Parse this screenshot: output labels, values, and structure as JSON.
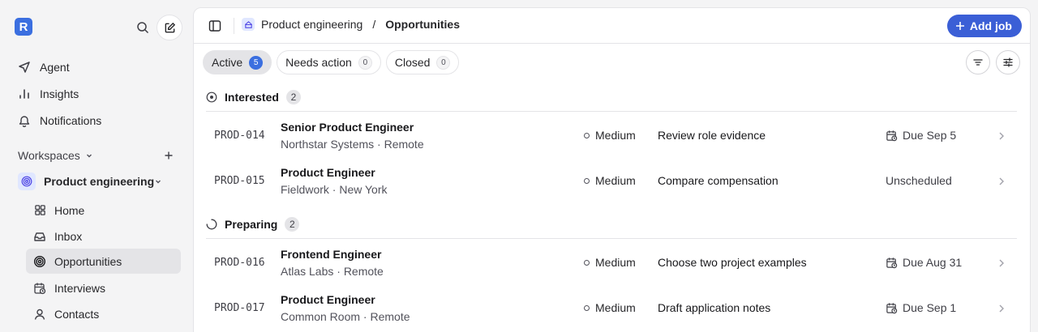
{
  "brand": {
    "letter": "R"
  },
  "sidebar": {
    "nav": [
      {
        "label": "Agent",
        "icon": "send-icon"
      },
      {
        "label": "Insights",
        "icon": "bar-chart-icon"
      },
      {
        "label": "Notifications",
        "icon": "bell-icon"
      }
    ],
    "workspaces_label": "Workspaces",
    "workspace": {
      "name": "Product engineering"
    },
    "sub_items": [
      {
        "label": "Home",
        "icon": "grid-icon"
      },
      {
        "label": "Inbox",
        "icon": "inbox-icon"
      },
      {
        "label": "Opportunities",
        "icon": "target-icon",
        "active": true
      },
      {
        "label": "Interviews",
        "icon": "calendar-clock-icon"
      },
      {
        "label": "Contacts",
        "icon": "person-icon"
      }
    ]
  },
  "header": {
    "breadcrumb_workspace": "Product engineering",
    "breadcrumb_separator": "/",
    "breadcrumb_current": "Opportunities",
    "add_job_label": "Add job"
  },
  "tabs": [
    {
      "label": "Active",
      "count": "5",
      "active": true
    },
    {
      "label": "Needs action",
      "count": "0"
    },
    {
      "label": "Closed",
      "count": "0"
    }
  ],
  "groups": [
    {
      "label": "Interested",
      "count": "2",
      "icon": "circle-dot-icon",
      "rows": [
        {
          "code": "PROD-014",
          "title": "Senior Product Engineer",
          "sub": "Northstar Systems · Remote",
          "priority": "Medium",
          "task": "Review role evidence",
          "due": "Due Sep 5",
          "has_due_icon": true
        },
        {
          "code": "PROD-015",
          "title": "Product Engineer",
          "sub": "Fieldwork · New York",
          "priority": "Medium",
          "task": "Compare compensation",
          "due": "Unscheduled",
          "has_due_icon": false
        }
      ]
    },
    {
      "label": "Preparing",
      "count": "2",
      "icon": "progress-spinner-icon",
      "rows": [
        {
          "code": "PROD-016",
          "title": "Frontend Engineer",
          "sub": "Atlas Labs · Remote",
          "priority": "Medium",
          "task": "Choose two project examples",
          "due": "Due Aug 31",
          "has_due_icon": true
        },
        {
          "code": "PROD-017",
          "title": "Product Engineer",
          "sub": "Common Room · Remote",
          "priority": "Medium",
          "task": "Draft application notes",
          "due": "Due Sep 1",
          "has_due_icon": true
        }
      ]
    }
  ],
  "colors": {
    "accent": "#3b5fd6",
    "badge": "#3b6fe0",
    "active_bg": "#e4e4e7"
  }
}
